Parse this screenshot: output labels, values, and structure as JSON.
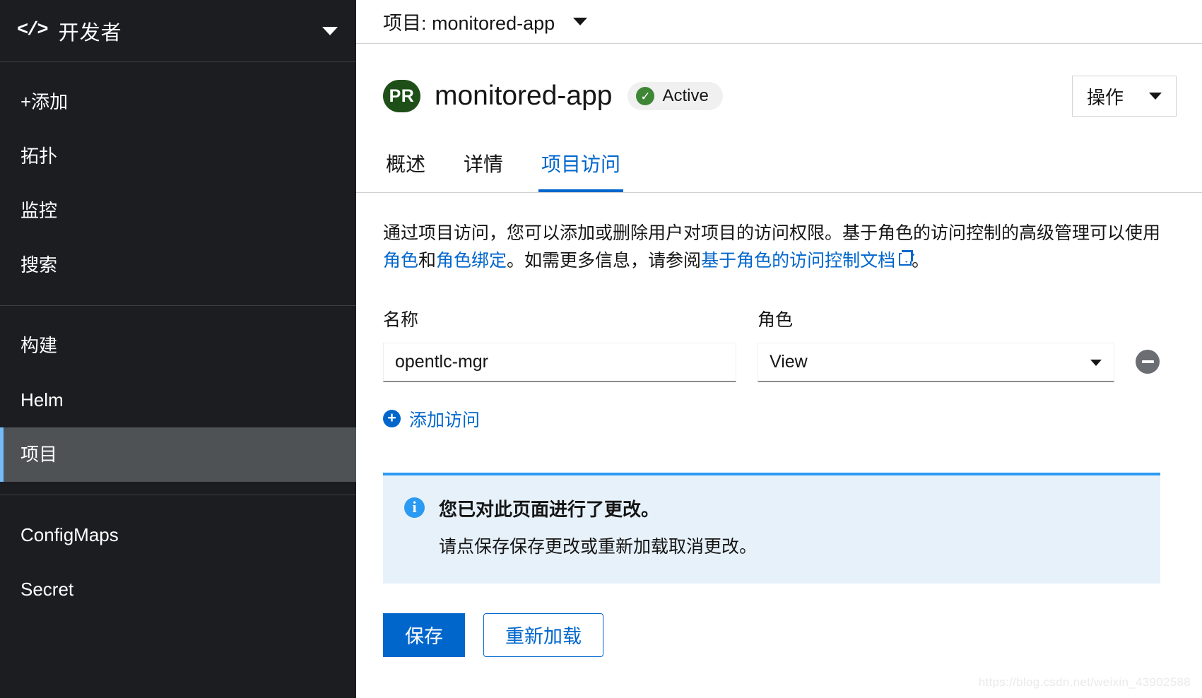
{
  "sidebar": {
    "perspective": {
      "icon": "code-icon",
      "label": "开发者",
      "caret": "chevron-down-icon"
    },
    "groups": [
      {
        "items": [
          {
            "label": "+添加",
            "name": "add",
            "active": false
          },
          {
            "label": "拓扑",
            "name": "topology",
            "active": false
          },
          {
            "label": "监控",
            "name": "monitoring",
            "active": false
          },
          {
            "label": "搜索",
            "name": "search",
            "active": false
          }
        ]
      },
      {
        "items": [
          {
            "label": "构建",
            "name": "builds",
            "active": false
          },
          {
            "label": "Helm",
            "name": "helm",
            "active": false
          },
          {
            "label": "项目",
            "name": "project",
            "active": true
          }
        ]
      },
      {
        "items": [
          {
            "label": "ConfigMaps",
            "name": "configmaps",
            "active": false
          },
          {
            "label": "Secret",
            "name": "secret",
            "active": false
          }
        ]
      }
    ]
  },
  "project_bar": {
    "label": "项目: ",
    "value": "monitored-app",
    "caret": "chevron-down-icon"
  },
  "header": {
    "badge": "PR",
    "title": "monitored-app",
    "status": {
      "label": "Active",
      "icon": "check-circle-icon",
      "color": "#3e8635"
    },
    "actions_button": "操作"
  },
  "tabs": [
    {
      "label": "概述",
      "selected": false
    },
    {
      "label": "详情",
      "selected": false
    },
    {
      "label": "项目访问",
      "selected": true
    }
  ],
  "description": {
    "part1": "通过项目访问，您可以添加或删除用户对项目的访问权限。基于角色的访问控制的高级管理可以使用",
    "link_roles": "角色",
    "conj": "和",
    "link_rolebindings": "角色绑定",
    "part2": "。如需更多信息，请参阅",
    "link_docs": "基于角色的访问控制文档",
    "external_icon": "external-link-icon",
    "part3": "。"
  },
  "form": {
    "name_label": "名称",
    "role_label": "角色",
    "rows": [
      {
        "name_value": "opentlc-mgr",
        "name_placeholder": "",
        "role_value": "View",
        "remove_icon": "minus-circle-icon"
      }
    ],
    "add_access_label": "添加访问",
    "add_icon": "plus-circle-icon"
  },
  "alert": {
    "icon": "info-circle-icon",
    "accent_color": "#2b9af3",
    "background_color": "#e7f1fa",
    "title": "您已对此页面进行了更改。",
    "description": "请点保存保存更改或重新加载取消更改。"
  },
  "buttons": {
    "save": "保存",
    "reload": "重新加载",
    "primary_color": "#06c"
  },
  "watermark": "https://blog.csdn.net/weixin_43902588"
}
